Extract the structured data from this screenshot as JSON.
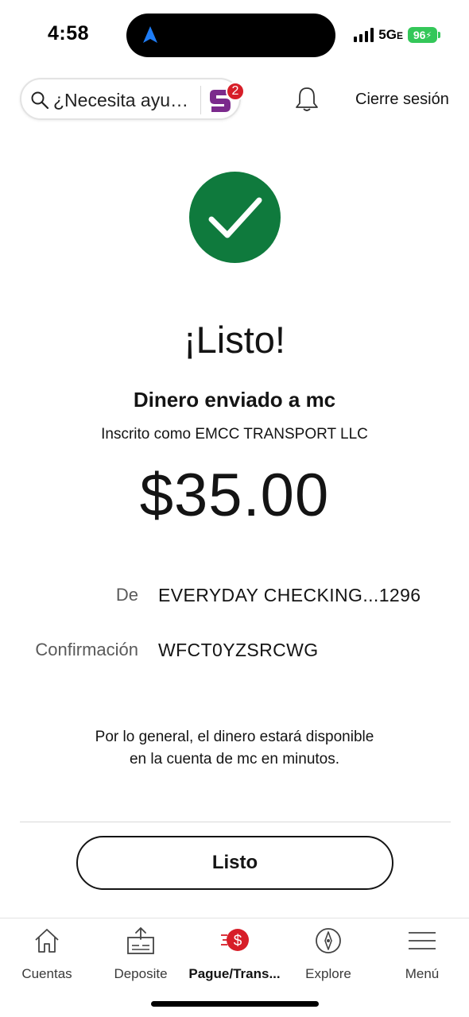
{
  "status_bar": {
    "time": "4:58",
    "network": "5G",
    "network_suffix": "E",
    "battery": "96"
  },
  "header": {
    "search_placeholder": "¿Necesita ayu…",
    "assistant_badge_count": "2",
    "logout_label": "Cierre sesión"
  },
  "confirmation": {
    "title": "¡Listo!",
    "subtitle": "Dinero enviado a mc",
    "enrolled_as": "Inscrito como EMCC TRANSPORT LLC",
    "amount": "$35.00",
    "from_label": "De",
    "from_value": "EVERYDAY CHECKING...1296",
    "confirmation_label": "Confirmación",
    "confirmation_value": "WFCT0YZSRCWG",
    "note_line1": "Por lo general, el dinero estará disponible",
    "note_line2": "en la cuenta de mc en minutos.",
    "done_button": "Listo"
  },
  "bottom_nav": {
    "items": [
      {
        "label": "Cuentas",
        "icon": "home-icon"
      },
      {
        "label": "Deposite",
        "icon": "deposit-icon"
      },
      {
        "label": "Pague/Trans...",
        "icon": "pay-transfer-icon",
        "active": true
      },
      {
        "label": "Explore",
        "icon": "compass-icon"
      },
      {
        "label": "Menú",
        "icon": "hamburger-menu-icon"
      }
    ]
  },
  "colors": {
    "success_green": "#0f7a3d",
    "brand_red": "#d71e28",
    "assistant_purple": "#7b2a8c",
    "battery_green": "#34c759"
  }
}
